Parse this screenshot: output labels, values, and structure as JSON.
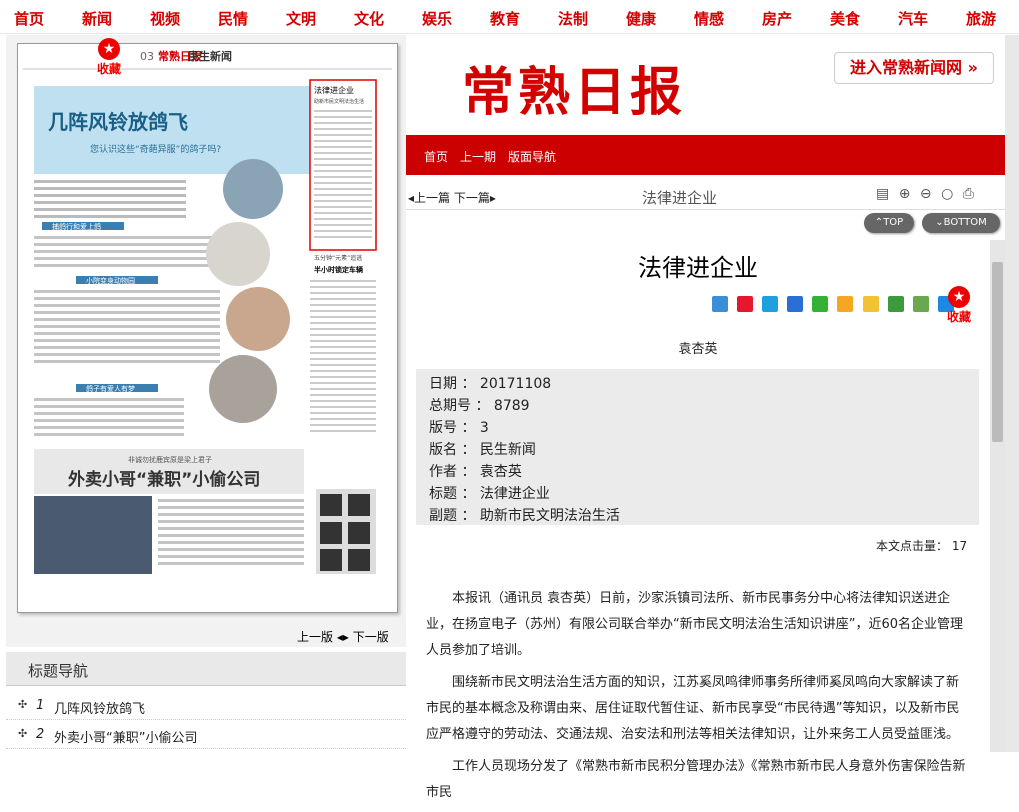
{
  "nav": [
    "首页",
    "新闻",
    "视频",
    "民情",
    "文明",
    "文化",
    "娱乐",
    "教育",
    "法制",
    "健康",
    "情感",
    "房产",
    "美食",
    "汽车",
    "旅游"
  ],
  "logo": "常熟日报",
  "enter_site": "进入常熟新闻网",
  "redbar": [
    "首页",
    "上一期",
    "版面导航"
  ],
  "toolbar": {
    "prev": "上一篇",
    "next": "下一篇",
    "title": "法律进企业"
  },
  "top_btn": "TOP",
  "bottom_btn": "BOTTOM",
  "favorite": "收藏",
  "article": {
    "title": "法律进企业",
    "author": "袁杏英",
    "meta": [
      {
        "label": "日期",
        "value": "20171108"
      },
      {
        "label": "总期号",
        "value": "8789"
      },
      {
        "label": "版号",
        "value": "3"
      },
      {
        "label": "版名",
        "value": "民生新闻"
      },
      {
        "label": "作者",
        "value": "袁杏英"
      },
      {
        "label": "标题",
        "value": "法律进企业"
      },
      {
        "label": "副题",
        "value": "助新市民文明法治生活"
      }
    ],
    "clicks_label": "本文点击量：",
    "clicks": "17",
    "paragraphs": [
      "本报讯（通讯员 袁杏英）日前，沙家浜镇司法所、新市民事务分中心将法律知识送进企业，在扬宣电子（苏州）有限公司联合举办“新市民文明法治生活知识讲座”，近60名企业管理人员参加了培训。",
      "围绕新市民文明法治生活方面的知识，江苏奚凤鸣律师事务所律师奚凤鸣向大家解读了新市民的基本概念及称谓由来、居住证取代暂住证、新市民享受“市民待遇”等知识，以及新市民应严格遵守的劳动法、交通法规、治安法和刑法等相关法律知识，让外来务工人员受益匪浅。",
      "工作人员现场分发了《常熟市新市民积分管理办法》《常熟市新市民人身意外伤害保险告新市民"
    ]
  },
  "paper": {
    "page_no": "03",
    "paper_name": "常熟日报",
    "section": "民生新闻",
    "headline1": "几阵风铃放鸽飞",
    "sub1": "您认识这些“奇葩异服”的鸽子吗?",
    "box_title": "法律进企业",
    "box_sub": "助新市民文明法治生活",
    "mid_title": "五分钟“元素”追逃",
    "mid_sub": "半小时锁定车辆",
    "h_a": "捕鸽行和爱上鸽",
    "h_b": "小院变身动物园",
    "h_c": "鸽子有爱人有梦",
    "kicker2": "非诚勿扰鹿宾原是梁上君子",
    "headline2": "外卖小哥“兼职”小偷公司"
  },
  "page_nav": {
    "prev": "上一版",
    "next": "下一版"
  },
  "title_nav": {
    "heading": "标题导航",
    "items": [
      {
        "num": "1",
        "label": "几阵风铃放鸽飞"
      },
      {
        "num": "2",
        "label": "外卖小哥“兼职”小偷公司"
      }
    ]
  },
  "colors": {
    "brand_red": "#d40000",
    "bar_red": "#cc0000",
    "meta_bg": "#ebebeb"
  }
}
